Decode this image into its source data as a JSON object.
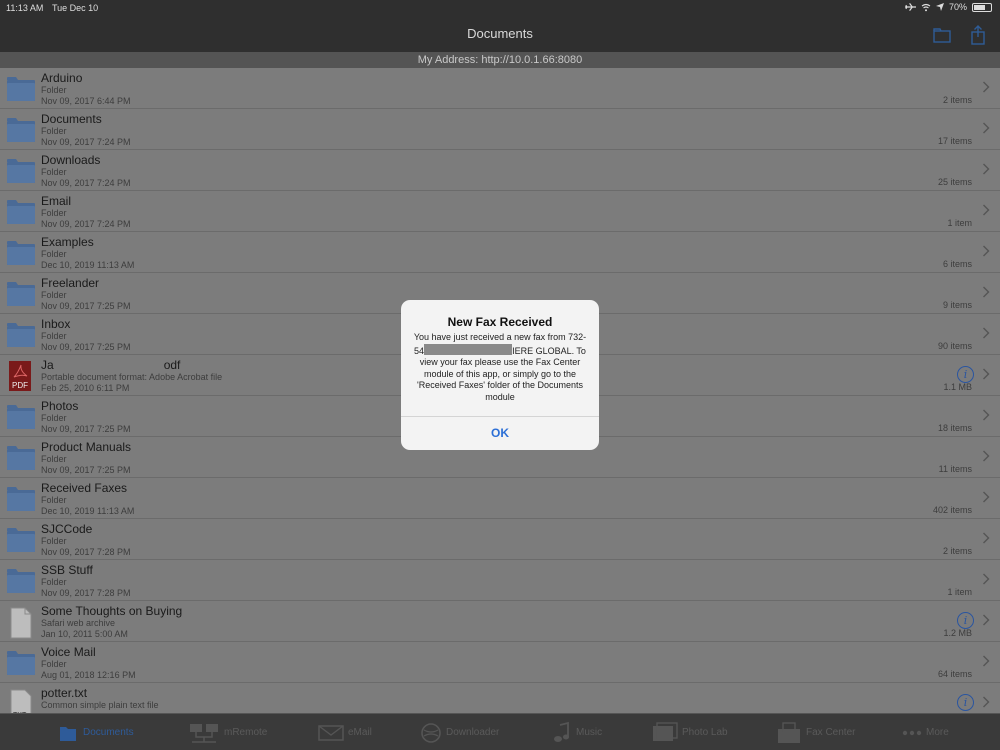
{
  "status_bar": {
    "time": "11:13 AM",
    "date": "Tue Dec 10",
    "battery": "70%",
    "battery_level": 0.7
  },
  "nav": {
    "title": "Documents"
  },
  "address": {
    "label": "My Address: http://10.0.1.66:8080"
  },
  "items": [
    {
      "name": "Arduino",
      "kind": "Folder",
      "date": "Nov 09, 2017 6:44 PM",
      "count": "2 items",
      "icon": "folder-icon"
    },
    {
      "name": "Documents",
      "kind": "Folder",
      "date": "Nov 09, 2017 7:24 PM",
      "count": "17 items",
      "icon": "folder-icon"
    },
    {
      "name": "Downloads",
      "kind": "Folder",
      "date": "Nov 09, 2017 7:24 PM",
      "count": "25 items",
      "icon": "folder-icon"
    },
    {
      "name": "Email",
      "kind": "Folder",
      "date": "Nov 09, 2017 7:24 PM",
      "count": "1 item",
      "icon": "folder-icon"
    },
    {
      "name": "Examples",
      "kind": "Folder",
      "date": "Dec 10, 2019 11:13 AM",
      "count": "6 items",
      "icon": "folder-icon"
    },
    {
      "name": "Freelander",
      "kind": "Folder",
      "date": "Nov 09, 2017 7:25 PM",
      "count": "9 items",
      "icon": "folder-icon"
    },
    {
      "name": "Inbox",
      "kind": "Folder",
      "date": "Nov 09, 2017 7:25 PM",
      "count": "90 items",
      "icon": "folder-icon"
    },
    {
      "name": "Ja",
      "name_end": "odf",
      "kind": "Portable document format: Adobe Acrobat file",
      "date": "Feb 25, 2010 6:11 PM",
      "count": "1.1 MB",
      "icon": "pdf-icon",
      "info": true
    },
    {
      "name": "Photos",
      "kind": "Folder",
      "date": "Nov 09, 2017 7:25 PM",
      "count": "18 items",
      "icon": "folder-icon"
    },
    {
      "name": "Product Manuals",
      "kind": "Folder",
      "date": "Nov 09, 2017 7:25 PM",
      "count": "11 items",
      "icon": "folder-icon"
    },
    {
      "name": "Received Faxes",
      "kind": "Folder",
      "date": "Dec 10, 2019 11:13 AM",
      "count": "402 items",
      "icon": "folder-icon"
    },
    {
      "name": "SJCCode",
      "kind": "Folder",
      "date": "Nov 09, 2017 7:28 PM",
      "count": "2 items",
      "icon": "folder-icon"
    },
    {
      "name": "SSB Stuff",
      "kind": "Folder",
      "date": "Nov 09, 2017 7:28 PM",
      "count": "1 item",
      "icon": "folder-icon"
    },
    {
      "name": "Some Thoughts on Buying",
      "kind": "Safari web archive",
      "date": "Jan 10, 2011 5:00 AM",
      "count": "1.2 MB",
      "icon": "webarchive-icon",
      "info": true
    },
    {
      "name": "Voice Mail",
      "kind": "Folder",
      "date": "Aug 01, 2018 12:16 PM",
      "count": "64 items",
      "icon": "folder-icon"
    },
    {
      "name": "potter.txt",
      "kind": "Common simple plain text file",
      "date": "",
      "count": "",
      "icon": "txt-icon",
      "info": true
    }
  ],
  "alert": {
    "title": "New Fax Received",
    "message_part1": "You have just received a new fax from 732-54",
    "message_part2": "IERE GLOBAL. To view your fax please use the Fax Center module of this app, or simply go to the 'Received Faxes' folder of the Documents module",
    "ok_label": "OK"
  },
  "tabs": [
    {
      "label": "Documents",
      "icon": "documents-icon",
      "active": true
    },
    {
      "label": "mRemote",
      "icon": "mremote-icon"
    },
    {
      "label": "eMail",
      "icon": "email-icon"
    },
    {
      "label": "Downloader",
      "icon": "downloader-icon"
    },
    {
      "label": "Music",
      "icon": "music-icon"
    },
    {
      "label": "Photo Lab",
      "icon": "photo-lab-icon"
    },
    {
      "label": "Fax Center",
      "icon": "fax-center-icon"
    },
    {
      "label": "More",
      "icon": "more-icon"
    }
  ],
  "colors": {
    "accent": "#2c6fd6",
    "nav_bg": "#2f2f2f",
    "list_bg": "#7c7c7c",
    "folder": "#4a6a96"
  }
}
